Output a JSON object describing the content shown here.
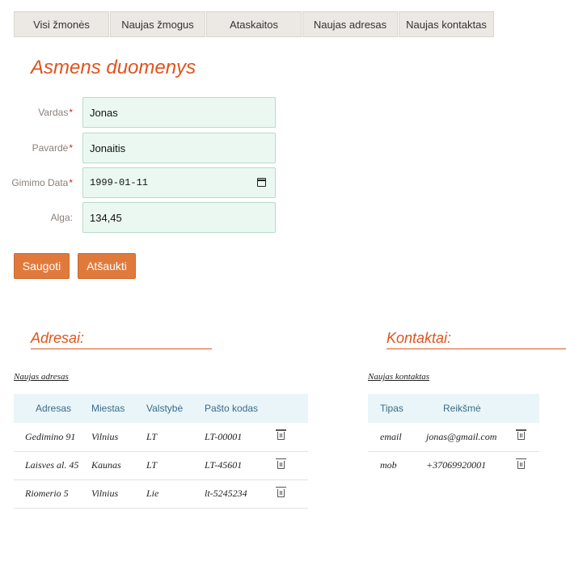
{
  "nav": {
    "tabs": [
      "Visi žmonės",
      "Naujas žmogus",
      "Ataskaitos",
      "Naujas adresas",
      "Naujas kontaktas"
    ]
  },
  "form": {
    "title": "Asmens duomenys",
    "required_mark": "*",
    "fields": [
      {
        "label": "Vardas",
        "value": "Jonas",
        "required": true
      },
      {
        "label": "Pavardė",
        "value": "Jonaitis",
        "required": true
      },
      {
        "label": "Gimimo Data",
        "value": "1999-01-11",
        "required": true
      },
      {
        "label": "Alga:",
        "value": "134,45",
        "required": false
      }
    ],
    "save_label": "Saugoti",
    "cancel_label": "Atšaukti"
  },
  "addresses": {
    "title": "Adresai:",
    "new_link": "Naujas adresas",
    "headers": [
      "Adresas",
      "Miestas",
      "Valstybė",
      "Pašto kodas"
    ],
    "rows": [
      {
        "address": "Gedimino 91",
        "city": "Vilnius",
        "country": "LT",
        "postal": "LT-00001"
      },
      {
        "address": "Laisves al. 45",
        "city": "Kaunas",
        "country": "LT",
        "postal": "LT-45601"
      },
      {
        "address": "Riomerio 5",
        "city": "Vilnius",
        "country": "Lie",
        "postal": "lt-5245234"
      }
    ]
  },
  "contacts": {
    "title": "Kontaktai:",
    "new_link": "Naujas kontaktas",
    "headers": [
      "Tipas",
      "Reikšmė"
    ],
    "rows": [
      {
        "type": "email",
        "value": "jonas@gmail.com"
      },
      {
        "type": "mob",
        "value": "+37069920001"
      }
    ]
  },
  "icons": {
    "delete": "trash-icon",
    "calendar": "calendar-icon"
  },
  "colors": {
    "accent": "#e0531d",
    "button": "#e07a3c",
    "input_bg": "#ebf8f1",
    "table_header_bg": "#eaf5f9",
    "tab_bg": "#ece9e5"
  }
}
